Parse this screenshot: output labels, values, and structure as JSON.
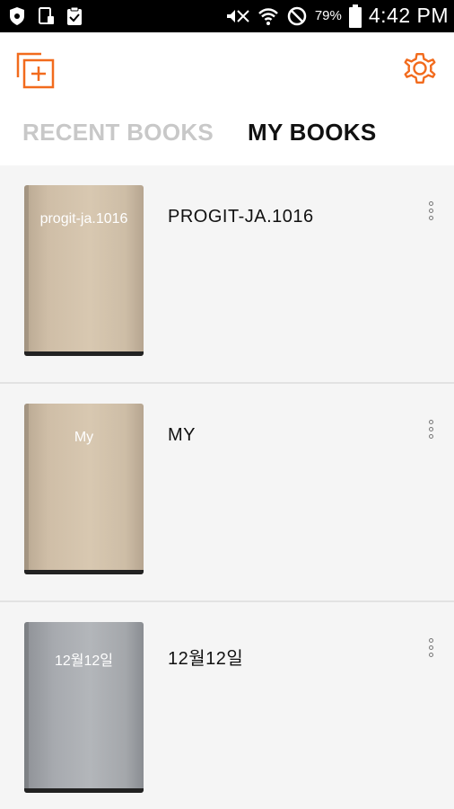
{
  "status_bar": {
    "battery_percent": "79%",
    "time": "4:42 PM"
  },
  "toolbar": {
    "add_icon": "add-book-icon",
    "settings_icon": "gear-icon",
    "accent_color": "#f26b1d"
  },
  "tabs": [
    {
      "label": "RECENT BOOKS",
      "active": false
    },
    {
      "label": "MY BOOKS",
      "active": true
    }
  ],
  "books": [
    {
      "cover_title": "progit-ja.1016",
      "title": "PROGIT-JA.1016",
      "cover_color": "tan"
    },
    {
      "cover_title": "My",
      "title": "MY",
      "cover_color": "tan"
    },
    {
      "cover_title": "12월12일",
      "title": "12월12일",
      "cover_color": "gray"
    }
  ]
}
